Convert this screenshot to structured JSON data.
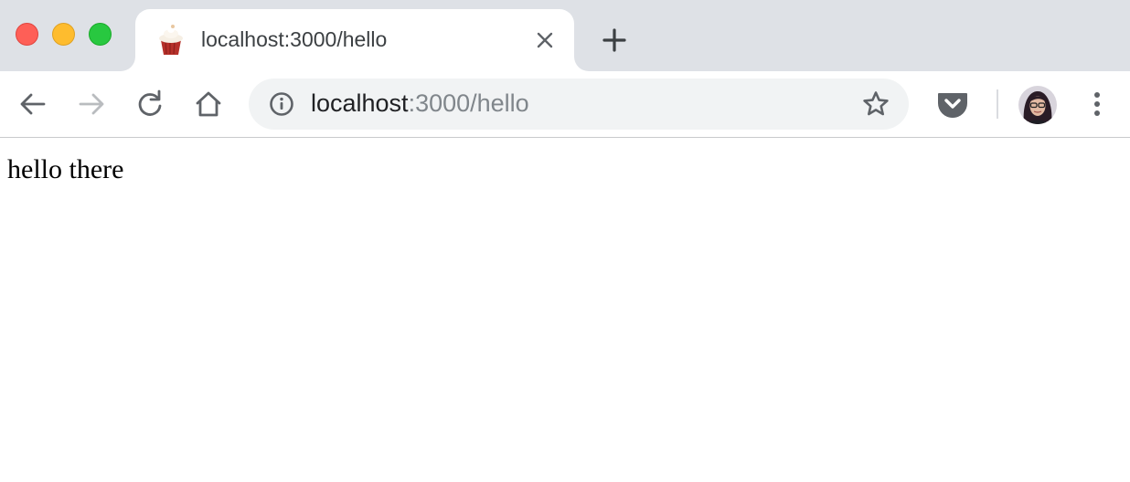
{
  "window": {
    "controls": [
      "close",
      "minimize",
      "maximize"
    ]
  },
  "tab": {
    "favicon": "cupcake-icon",
    "title": "localhost:3000/hello",
    "close_icon": "close-icon"
  },
  "tabstrip": {
    "new_tab_icon": "plus-icon"
  },
  "toolbar": {
    "back_icon": "back-arrow-icon",
    "forward_icon": "forward-arrow-icon",
    "reload_icon": "reload-icon",
    "home_icon": "home-icon",
    "extension_icon": "pocket-icon",
    "menu_icon": "kebab-menu-icon"
  },
  "omnibox": {
    "info_icon": "info-icon",
    "url_host": "localhost",
    "url_rest": ":3000/hello",
    "bookmark_icon": "star-icon"
  },
  "page": {
    "text": "hello there"
  },
  "colors": {
    "tabstrip_bg": "#dee1e6",
    "omnibox_bg": "#f1f3f4",
    "traffic_close": "#fe5f57",
    "traffic_minimize": "#febc2e",
    "traffic_maximize": "#28c840"
  }
}
